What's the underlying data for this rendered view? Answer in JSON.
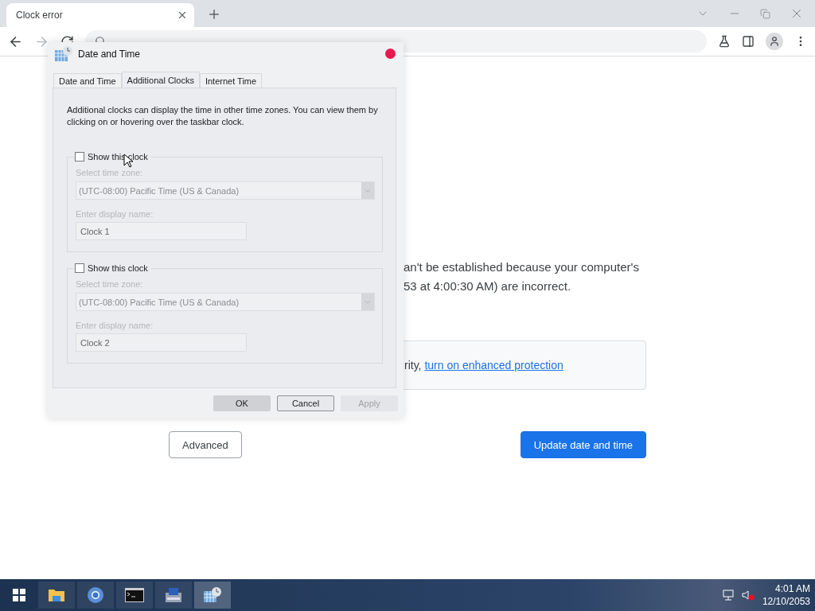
{
  "browser": {
    "tab": {
      "title": "Clock error",
      "selected": true
    }
  },
  "page": {
    "message_lines": [
      "an't be established because your computer's",
      "53 at 4:00:30 AM) are incorrect."
    ],
    "notice": {
      "text": "rity, ",
      "link": "turn on enhanced protection"
    },
    "buttons": [
      {
        "label": "Advanced",
        "kind": "secondary"
      },
      {
        "label": "Update date and time",
        "kind": "primary"
      }
    ]
  },
  "dialog": {
    "title": "Date and Time",
    "tabs": [
      {
        "label": "Date and Time",
        "selected": false
      },
      {
        "label": "Additional Clocks",
        "selected": true
      },
      {
        "label": "Internet Time",
        "selected": false
      }
    ],
    "description": "Additional clocks can display the time in other time zones. You can view them by clicking on or hovering over the taskbar clock.",
    "clocks": [
      {
        "label": "Show this clock",
        "checked": false,
        "timezone_label": "Select time zone:",
        "timezone": "(UTC-08:00) Pacific Time (US & Canada)",
        "name_label": "Enter display name:",
        "name": "Clock 1"
      },
      {
        "label": "Show this clock",
        "checked": false,
        "timezone_label": "Select time zone:",
        "timezone": "(UTC-08:00) Pacific Time (US & Canada)",
        "name_label": "Enter display name:",
        "name": "Clock 2"
      }
    ],
    "buttons": [
      {
        "label": "OK",
        "kind": "default",
        "disabled": false
      },
      {
        "label": "Cancel",
        "kind": "normal",
        "disabled": false
      },
      {
        "label": "Apply",
        "kind": "normal",
        "disabled": true
      }
    ]
  },
  "taskbar": {
    "apps": [
      {
        "kind": "folder",
        "selected": false
      },
      {
        "kind": "browser",
        "selected": false
      },
      {
        "kind": "terminal",
        "selected": false
      },
      {
        "kind": "installer",
        "selected": false
      },
      {
        "kind": "clock",
        "selected": true
      }
    ],
    "time": "4:01 AM",
    "date": "12/10/2053"
  }
}
